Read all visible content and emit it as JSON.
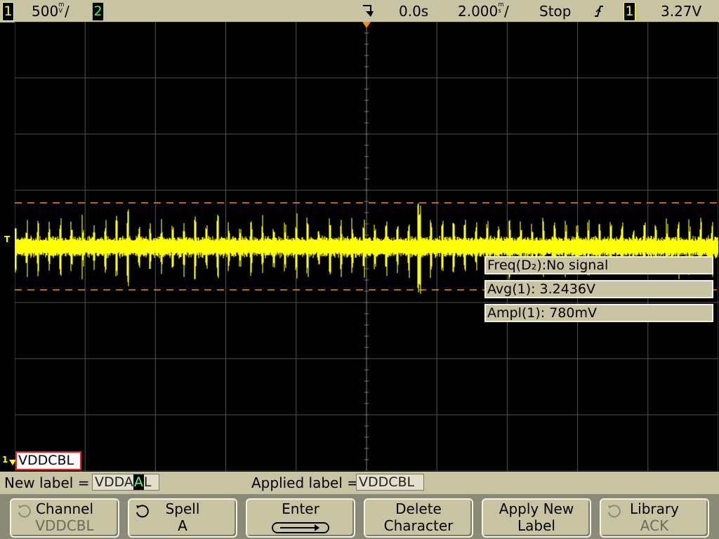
{
  "status": {
    "ch1_num": "1",
    "ch1_scale": "500",
    "ch1_unit_top": "m",
    "ch1_unit_bot": "V",
    "ch2_num": "2",
    "trigger_marker": "↵",
    "time_delay": "0.0s",
    "time_scale": "2.000",
    "time_unit_top": "m",
    "time_unit_bot": "s",
    "run_state": "Stop",
    "trigger_slope_icon": "rising-edge-icon",
    "trigger_source": "1",
    "trigger_level": "3.27V"
  },
  "measurements": [
    "Freq(D₂):No signal",
    "Avg(1): 3.2436V",
    "Ampl(1): 780mV"
  ],
  "channel_label_text": "VDDCBL",
  "marker_T": "T",
  "marker_1": "1",
  "label_row": {
    "new_label_caption": "New label =",
    "new_label_prefix": "VDDA",
    "new_label_cursor_char": "A",
    "new_label_suffix": "L",
    "applied_caption": "Applied label =",
    "applied_value": "VDDCBL"
  },
  "softkeys": [
    {
      "top": "Channel",
      "bottom": "VDDCBL",
      "icon": "rotary-knob-icon"
    },
    {
      "top": "Spell",
      "bottom": "A",
      "icon": "rotary-knob-icon"
    },
    {
      "top": "Enter",
      "bottom": "",
      "icon": "enter-arrow-icon"
    },
    {
      "top": "Delete",
      "bottom": "Character",
      "icon": ""
    },
    {
      "top": "Apply New",
      "bottom": "Label",
      "icon": ""
    },
    {
      "top": "Library",
      "bottom": "ACK",
      "icon": "rotary-knob-icon"
    }
  ],
  "colors": {
    "trace": "#ffff00",
    "grid": "#555555",
    "cursor_lines": "#ff8a00",
    "status_bg": "#c8c4a3",
    "label_border": "#ff1a1a"
  }
}
